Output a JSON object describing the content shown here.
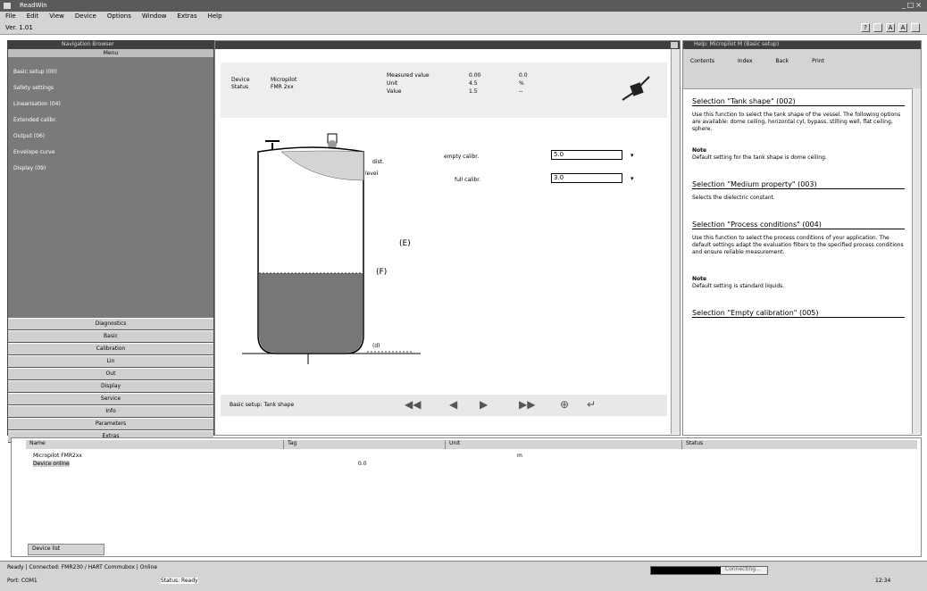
{
  "window": {
    "title": "ReadWin",
    "win_buttons": [
      "_",
      "□",
      "×"
    ]
  },
  "menubar": {
    "items": [
      "File",
      "Edit",
      "View",
      "Device",
      "Options",
      "Window",
      "Extras",
      "Help"
    ]
  },
  "toolbar": {
    "left_label": "Ver. 1.01",
    "right_icons": [
      "?",
      "□",
      "A",
      "A",
      "?",
      "?"
    ]
  },
  "nav_panel": {
    "title": "Navigation Browser",
    "subtitle": "Menu",
    "items": [
      "Basic setup (00)",
      "Safety settings",
      "Linearisation (04)",
      "Extended calibr.",
      "Output (06)",
      "Envelope curve",
      "Display (09)"
    ],
    "bottom_items": [
      "Diagnostics",
      "Basic",
      "Calibration",
      "Lin",
      "Out",
      "Display",
      "Service",
      "Info",
      "Parameters",
      "Extras"
    ]
  },
  "editor": {
    "header": {
      "col1": [
        "Device",
        "Status"
      ],
      "col2": [
        "Micropilot",
        "FMR 2xx"
      ],
      "col3": [
        "Measured value",
        "Unit",
        "Value"
      ],
      "col4": [
        "0.00",
        "4.5",
        "1.5"
      ],
      "col5": [
        "0.0",
        "%",
        "--"
      ]
    },
    "labels": {
      "dist": "dist.",
      "level": "level",
      "e": "(E)",
      "f": "(F)",
      "s": "(d)"
    },
    "fields": [
      {
        "label": "empty calibr.",
        "value": "5.0"
      },
      {
        "label": "full calibr.",
        "value": "3.0"
      }
    ],
    "footer_text": "Basic setup: Tank shape",
    "nav_icons": [
      "◀◀",
      "◀",
      "▶",
      "▶▶",
      "⊕",
      "↵"
    ]
  },
  "help_panel": {
    "title": "Help: Micropilot M (Basic setup)",
    "toolbar": [
      "Contents",
      "Index",
      "Back",
      "Print"
    ],
    "section1_title": "Selection \"Tank shape\" (002)",
    "section1_text": "Use this function to select the tank shape of the vessel. The following options are available: dome ceiling, horizontal cyl, bypass, stilling well, flat ceiling, sphere.",
    "section2_title": "Note",
    "section2_text": "Default setting for the tank shape is dome ceiling.",
    "section3_title": "Selection \"Medium property\" (003)",
    "section3_text": "Selects the dielectric constant.",
    "section4_title": "Selection \"Process conditions\" (004)",
    "section4_text": "Use this function to select the process conditions of your application. The default settings adapt the evaluation filters to the specified process conditions and ensure reliable measurement.",
    "section5_title": "Note",
    "section5_text": "Default setting is standard liquids.",
    "section6_title": "Selection \"Empty calibration\" (005)"
  },
  "bottom_table": {
    "columns": [
      "Name",
      "Tag",
      "Unit",
      "Status"
    ],
    "rows": [
      {
        "name": "Micropilot FMR2xx",
        "tag": "",
        "unit": "m",
        "status": ""
      },
      {
        "name": "Device online",
        "tag": "0.0",
        "unit": "",
        "status": ""
      }
    ],
    "tab": "Device list"
  },
  "statusbar": {
    "line1": "Ready | Connected: FMR230 / HART Commubox | Online",
    "line2_left": "Port: COM1",
    "line2_mid": "Status: Ready",
    "progress_label": "Connecting...",
    "clock": "12:34"
  }
}
